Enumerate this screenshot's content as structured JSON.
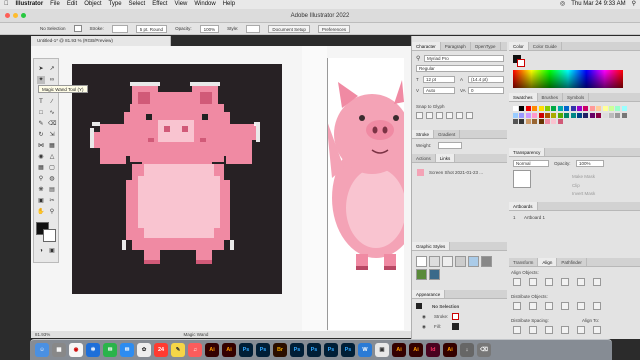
{
  "menubar": {
    "app": "Illustrator",
    "items": [
      "File",
      "Edit",
      "Object",
      "Type",
      "Select",
      "Effect",
      "View",
      "Window",
      "Help"
    ],
    "clock": "Thu Mar 24  9:33 AM"
  },
  "titlebar": {
    "title": "Adobe Illustrator 2022"
  },
  "control": {
    "selection": "No Selection",
    "stroke_label": "Stroke:",
    "brush": "5 pt. Round",
    "opacity_label": "Opacity:",
    "opacity": "100%",
    "style_label": "Style:",
    "doc_setup": "Document Setup",
    "preferences": "Preferences"
  },
  "document": {
    "tab": "Untitled-1* @ 81.93 % (RGB/Preview)",
    "zoom": "81.93%",
    "tool_status": "Magic Wand"
  },
  "tooltip": "Magic Wand Tool (Y)",
  "character_panel": {
    "tabs": [
      "Character",
      "Paragraph",
      "OpenType"
    ],
    "font": "Myriad Pro",
    "style": "Regular",
    "size": "12 pt",
    "leading": "(14.4 pt)",
    "tracking": "Auto",
    "kerning": "0",
    "snap": "Snap to Glyph"
  },
  "stroke_panel": {
    "tabs": [
      "Stroke",
      "Gradient"
    ],
    "weight_label": "Weight:"
  },
  "actions_panel": {
    "tabs": [
      "Actions",
      "Links"
    ],
    "link_name": "Screen Shot 2021-01-23 ..."
  },
  "graphic_styles": {
    "title": "Graphic Styles"
  },
  "appearance": {
    "title": "Appearance",
    "selection": "No Selection",
    "stroke_label": "Stroke:",
    "fill_label": "Fill:"
  },
  "color_panel": {
    "tabs": [
      "Color",
      "Color Guide"
    ]
  },
  "swatches_panel": {
    "tabs": [
      "Swatches",
      "Brushes",
      "Symbols"
    ]
  },
  "transparency": {
    "title": "Transparency",
    "mode": "Normal",
    "opacity_label": "Opacity:",
    "opacity": "100%",
    "make_mask": "Make Mask",
    "clip": "Clip",
    "invert": "Invert Mask"
  },
  "artboards": {
    "title": "Artboards",
    "row_num": "1",
    "row_name": "Artboard 1"
  },
  "align_panel": {
    "tabs": [
      "Transform",
      "Align",
      "Pathfinder"
    ],
    "align_objects": "Align Objects:",
    "distribute_objects": "Distribute Objects:",
    "distribute_spacing": "Distribute Spacing:",
    "align_to": "Align To:"
  },
  "dock": {
    "apps": [
      {
        "label": "Ai",
        "color": "#330000",
        "fg": "#ff9a00"
      },
      {
        "label": "Ai",
        "color": "#330000",
        "fg": "#ff9a00"
      },
      {
        "label": "Ps",
        "color": "#001e36",
        "fg": "#31a8ff"
      },
      {
        "label": "Ps",
        "color": "#001e36",
        "fg": "#31a8ff"
      },
      {
        "label": "Br",
        "color": "#2a0e00",
        "fg": "#e8a300"
      },
      {
        "label": "Ps",
        "color": "#001e36",
        "fg": "#31a8ff"
      },
      {
        "label": "Ps",
        "color": "#001e36",
        "fg": "#31a8ff"
      },
      {
        "label": "Ps",
        "color": "#001e36",
        "fg": "#31a8ff"
      },
      {
        "label": "Ps",
        "color": "#001e36",
        "fg": "#31a8ff"
      },
      {
        "label": "Ai",
        "color": "#330000",
        "fg": "#ff9a00"
      },
      {
        "label": "Ai",
        "color": "#330000",
        "fg": "#ff9a00"
      },
      {
        "label": "Id",
        "color": "#49021f",
        "fg": "#ff3366"
      },
      {
        "label": "Ai",
        "color": "#330000",
        "fg": "#ff9a00"
      }
    ]
  },
  "colors": {
    "pig_pink": "#f08aa3",
    "pig_light": "#f9c4d0",
    "pig_dark": "#d15a78",
    "vector_pig": "#f4a3b6",
    "artboard_bg": "#272124"
  }
}
